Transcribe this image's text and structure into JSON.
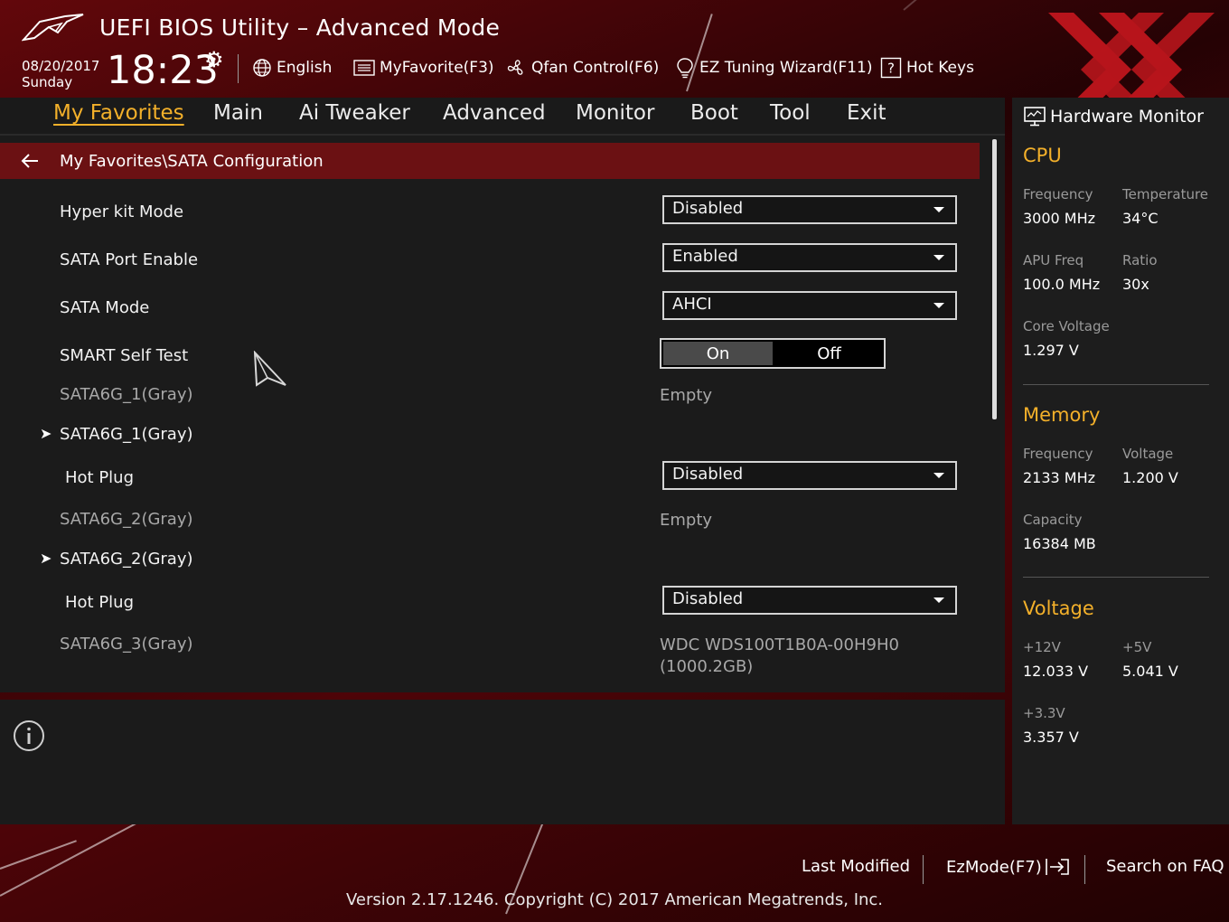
{
  "header": {
    "title": "UEFI BIOS Utility – Advanced Mode",
    "date": "08/20/2017",
    "day": "Sunday",
    "time": "18:23",
    "toolbar": {
      "language": "English",
      "my_favorite": "MyFavorite(F3)",
      "qfan": "Qfan Control(F6)",
      "ez_tuning": "EZ Tuning Wizard(F11)",
      "hot_keys": "Hot Keys"
    }
  },
  "nav": {
    "tabs": [
      "My Favorites",
      "Main",
      "Ai Tweaker",
      "Advanced",
      "Monitor",
      "Boot",
      "Tool",
      "Exit"
    ],
    "active": "My Favorites"
  },
  "breadcrumb": "My Favorites\\SATA Configuration",
  "settings": {
    "hyper_kit": {
      "label": "Hyper kit Mode",
      "value": "Disabled"
    },
    "sata_port_enable": {
      "label": "SATA Port Enable",
      "value": "Enabled"
    },
    "sata_mode": {
      "label": "SATA Mode",
      "value": "AHCI"
    },
    "smart_self_test": {
      "label": "SMART Self Test",
      "on": "On",
      "off": "Off",
      "selected": "On"
    },
    "sata1_info": {
      "label": "SATA6G_1(Gray)",
      "value": "Empty"
    },
    "sata1_sub": {
      "label": "SATA6G_1(Gray)"
    },
    "hot_plug_1": {
      "label": "Hot Plug",
      "value": "Disabled"
    },
    "sata2_info": {
      "label": "SATA6G_2(Gray)",
      "value": "Empty"
    },
    "sata2_sub": {
      "label": "SATA6G_2(Gray)"
    },
    "hot_plug_2": {
      "label": "Hot Plug",
      "value": "Disabled"
    },
    "sata3_info": {
      "label": "SATA6G_3(Gray)",
      "value_line1": "WDC WDS100T1B0A-00H9H0",
      "value_line2": "(1000.2GB)"
    }
  },
  "hw_monitor": {
    "title": "Hardware Monitor",
    "cpu": {
      "section": "CPU",
      "frequency_label": "Frequency",
      "frequency": "3000 MHz",
      "temperature_label": "Temperature",
      "temperature": "34°C",
      "apu_label": "APU Freq",
      "apu": "100.0 MHz",
      "ratio_label": "Ratio",
      "ratio": "30x",
      "core_voltage_label": "Core Voltage",
      "core_voltage": "1.297 V"
    },
    "memory": {
      "section": "Memory",
      "frequency_label": "Frequency",
      "frequency": "2133 MHz",
      "voltage_label": "Voltage",
      "voltage": "1.200 V",
      "capacity_label": "Capacity",
      "capacity": "16384 MB"
    },
    "voltage": {
      "section": "Voltage",
      "v12_label": "+12V",
      "v12": "12.033 V",
      "v5_label": "+5V",
      "v5": "5.041 V",
      "v33_label": "+3.3V",
      "v33": "3.357 V"
    }
  },
  "footer": {
    "last_modified": "Last Modified",
    "ezmode": "EzMode(F7)",
    "search_faq": "Search on FAQ",
    "version": "Version 2.17.1246. Copyright (C) 2017 American Megatrends, Inc."
  },
  "colors": {
    "accent": "#f3b02a",
    "breadcrumb_bg": "#6b1113",
    "panel_bg": "#1b1b1b"
  }
}
